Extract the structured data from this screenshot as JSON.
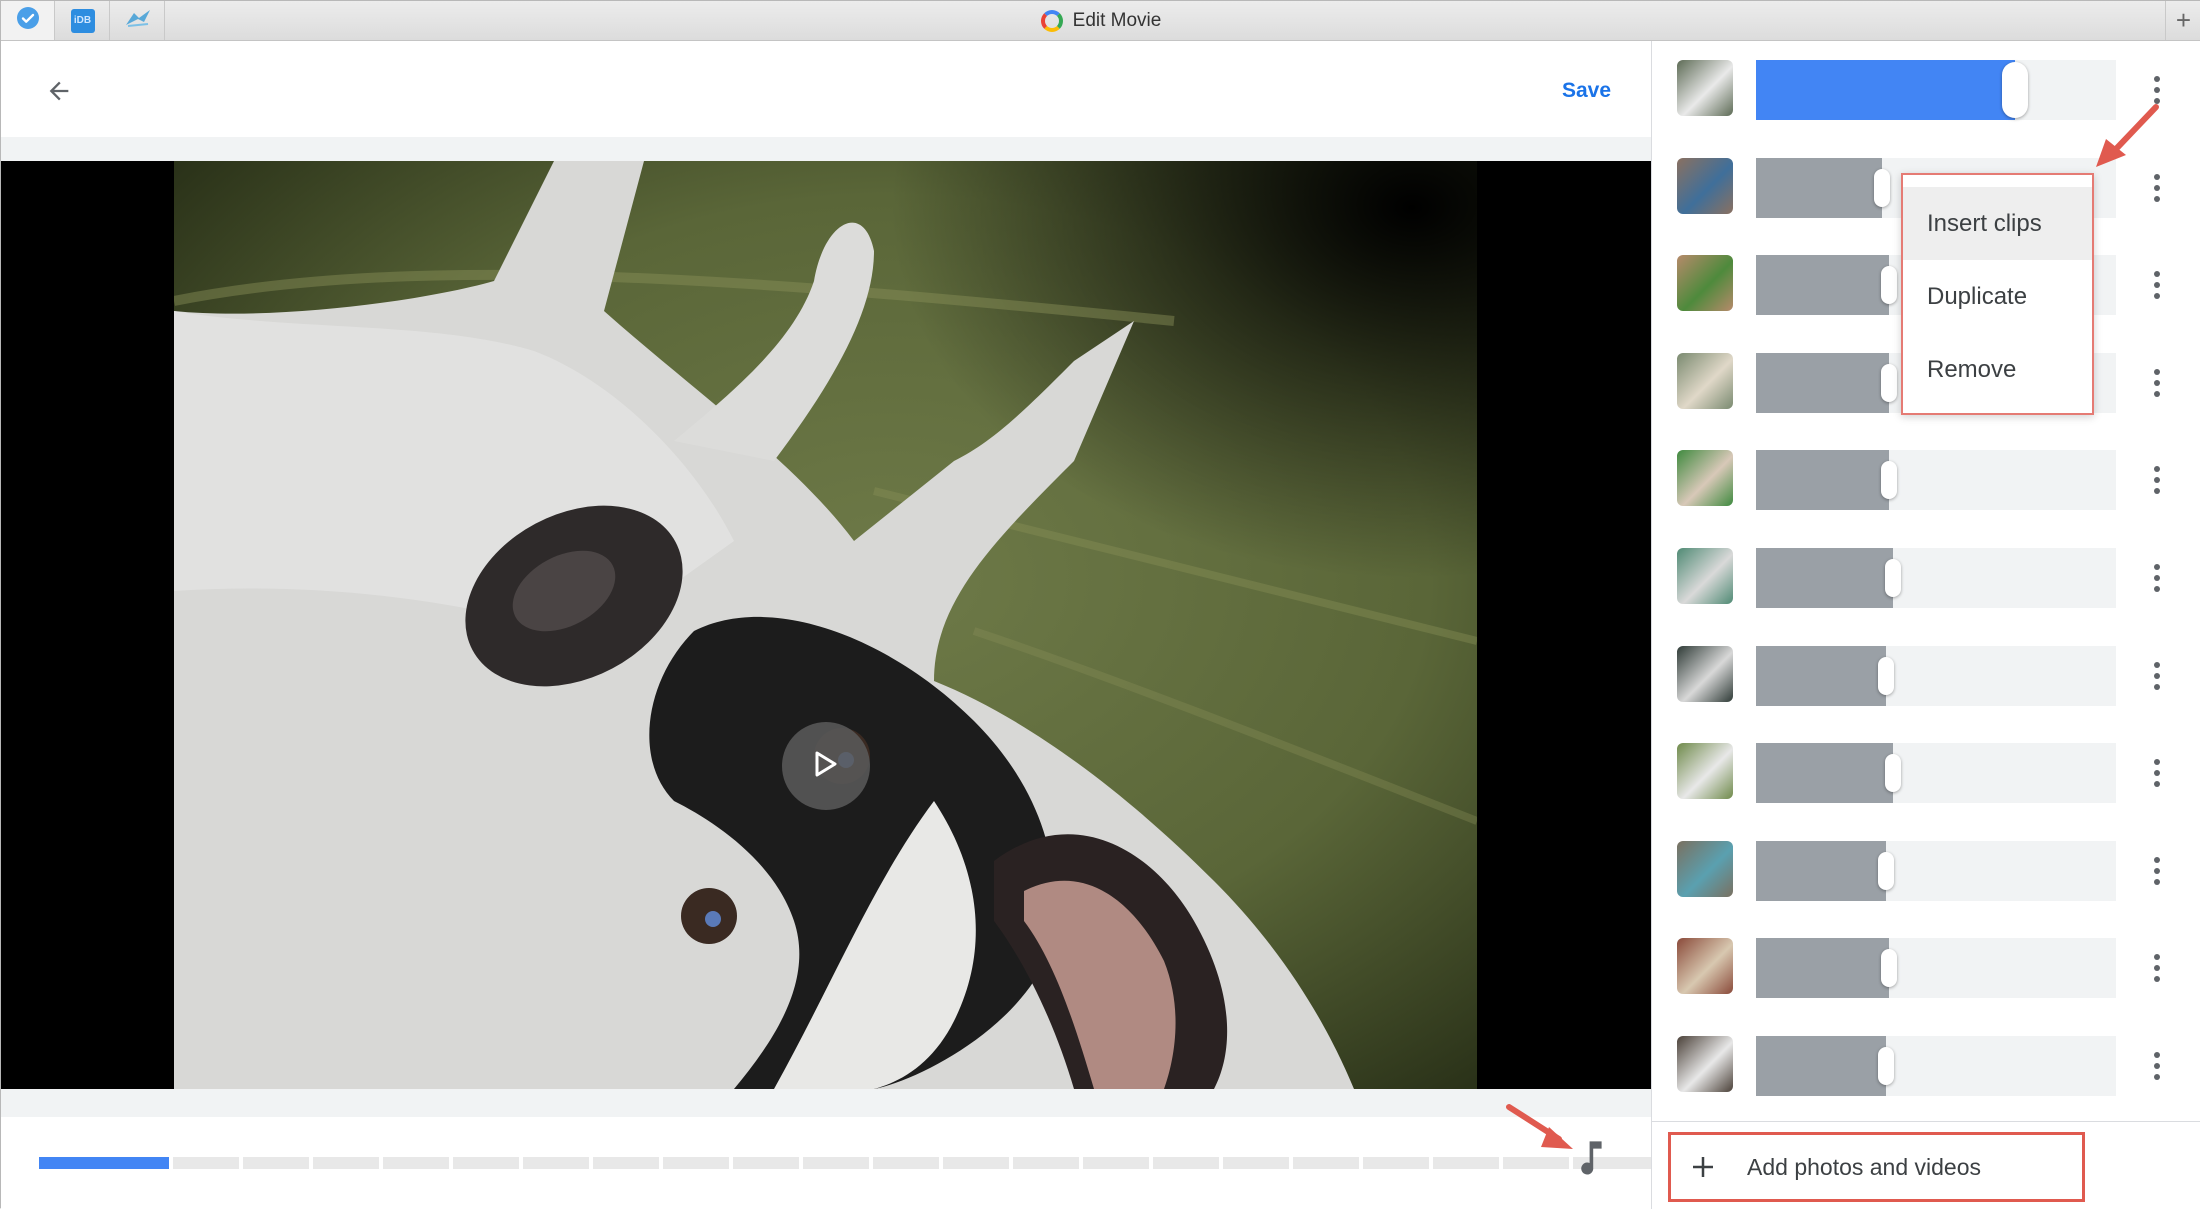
{
  "window": {
    "title": "Edit Movie",
    "tabs": [
      {
        "icon": "checkmark-badge-icon"
      },
      {
        "icon": "idb-app-icon",
        "text": "iDB"
      },
      {
        "icon": "bird-app-icon"
      }
    ]
  },
  "header": {
    "back_icon": "arrow-left-icon",
    "save_label": "Save"
  },
  "player": {
    "play_icon": "play-icon",
    "timeline": {
      "segments": 22,
      "played_segments": 1
    },
    "music_icon": "music-note-icon"
  },
  "clips": [
    {
      "thumb_colors": [
        "#5d6b55",
        "#e9e9e9"
      ],
      "trim_fraction": 0.72,
      "active": true
    },
    {
      "thumb_colors": [
        "#8a7060",
        "#3f6f9a"
      ],
      "trim_fraction": 0.35,
      "active": false
    },
    {
      "thumb_colors": [
        "#b68a6a",
        "#4e8a3c"
      ],
      "trim_fraction": 0.37,
      "active": false
    },
    {
      "thumb_colors": [
        "#7a8a70",
        "#e0d8c8"
      ],
      "trim_fraction": 0.37,
      "active": false
    },
    {
      "thumb_colors": [
        "#3f8a3f",
        "#d8c8b8"
      ],
      "trim_fraction": 0.37,
      "active": false
    },
    {
      "thumb_colors": [
        "#4f8a74",
        "#d9d9d9"
      ],
      "trim_fraction": 0.38,
      "active": false
    },
    {
      "thumb_colors": [
        "#2e3a36",
        "#d8d8d8"
      ],
      "trim_fraction": 0.36,
      "active": false
    },
    {
      "thumb_colors": [
        "#6f8a4a",
        "#e8e8e8"
      ],
      "trim_fraction": 0.38,
      "active": false
    },
    {
      "thumb_colors": [
        "#7a7060",
        "#5aa0b0"
      ],
      "trim_fraction": 0.36,
      "active": false
    },
    {
      "thumb_colors": [
        "#8a4a3a",
        "#d8c8b0"
      ],
      "trim_fraction": 0.37,
      "active": false
    },
    {
      "thumb_colors": [
        "#4a4038",
        "#e8e8e8"
      ],
      "trim_fraction": 0.36,
      "active": false
    }
  ],
  "clip_menu": {
    "items": [
      "Insert clips",
      "Duplicate",
      "Remove"
    ],
    "highlighted_index": 0
  },
  "add_media": {
    "icon": "plus-icon",
    "label": "Add photos and videos"
  },
  "colors": {
    "accent": "#1a73e8",
    "track_active": "#4285f4",
    "track_fill": "#9aa0a6",
    "annotation": "#e05a4f"
  }
}
